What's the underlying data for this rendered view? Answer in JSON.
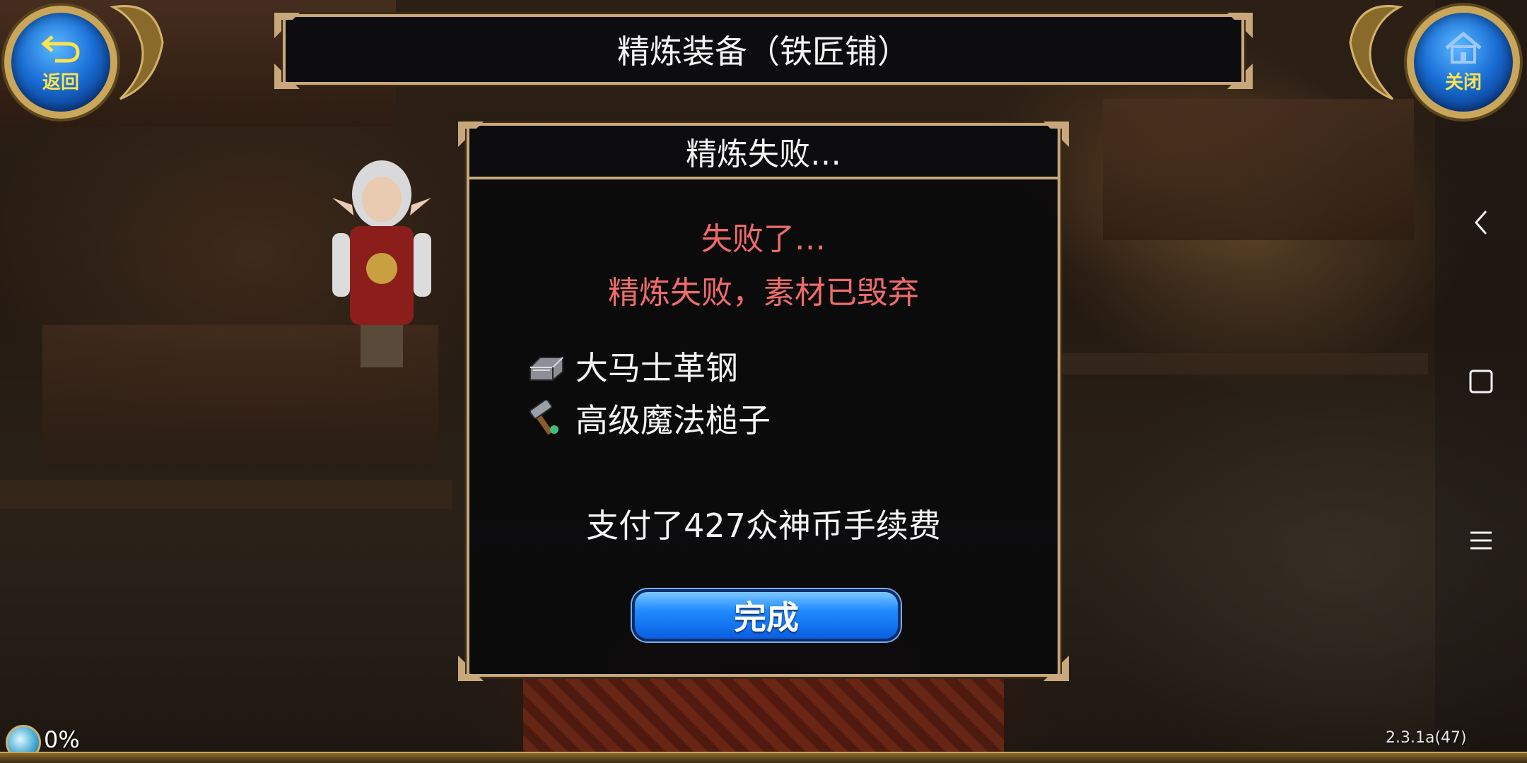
{
  "window": {
    "title": "精炼装备（铁匠铺）"
  },
  "top_buttons": {
    "back_label": "返回",
    "close_label": "关闭"
  },
  "dialog": {
    "header": "精炼失败…",
    "fail_short": "失败了…",
    "fail_detail": "精炼失败，素材已毁弃",
    "items": [
      {
        "icon": "steel-ingot-icon",
        "name": "大马士革钢"
      },
      {
        "icon": "magic-hammer-icon",
        "name": "高级魔法槌子"
      }
    ],
    "fee_text": "支付了427众神币手续费",
    "done_label": "完成"
  },
  "hud": {
    "exp_percent": "0%",
    "version": "2.3.1a(47)"
  },
  "system_nav": {
    "back_icon": "chevron-left-icon",
    "home_icon": "square-icon",
    "menu_icon": "menu-icon"
  },
  "colors": {
    "accent_blue": "#1f8bff",
    "fail_red": "#f06c6c",
    "frame_gold": "#c8a87a"
  }
}
